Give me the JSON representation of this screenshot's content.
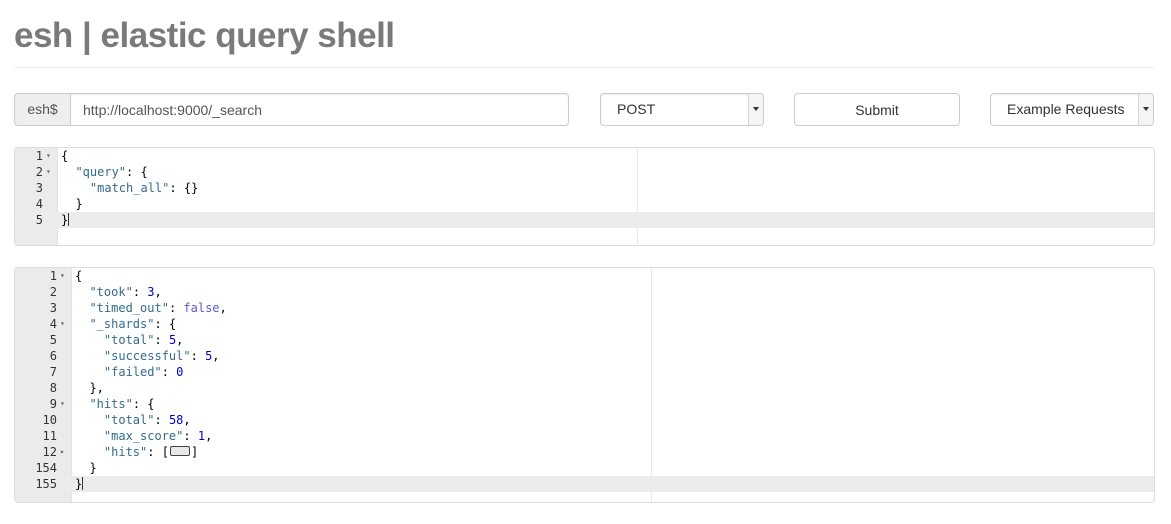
{
  "app": {
    "title": "esh | elastic query shell"
  },
  "toolbar": {
    "prompt": "esh$",
    "url_value": "http://localhost:9000/_search",
    "method_selected": "POST",
    "submit_label": "Submit",
    "examples_label": "Example Requests"
  },
  "request": {
    "lines": [
      {
        "num": "1",
        "fold": "▾",
        "parts": [
          {
            "t": "p",
            "v": "{"
          }
        ]
      },
      {
        "num": "2",
        "fold": "▾",
        "parts": [
          {
            "t": "p",
            "v": "  "
          },
          {
            "t": "k",
            "v": "\"query\""
          },
          {
            "t": "p",
            "v": ": {"
          }
        ]
      },
      {
        "num": "3",
        "fold": "",
        "parts": [
          {
            "t": "p",
            "v": "    "
          },
          {
            "t": "k",
            "v": "\"match_all\""
          },
          {
            "t": "p",
            "v": ": {}"
          }
        ]
      },
      {
        "num": "4",
        "fold": "",
        "parts": [
          {
            "t": "p",
            "v": "  }"
          }
        ]
      },
      {
        "num": "5",
        "fold": "",
        "active": true,
        "parts": [
          {
            "t": "p",
            "v": "}"
          },
          {
            "t": "c",
            "v": ""
          }
        ]
      }
    ]
  },
  "response": {
    "lines": [
      {
        "num": "1",
        "fold": "▾",
        "parts": [
          {
            "t": "p",
            "v": "{"
          }
        ]
      },
      {
        "num": "2",
        "fold": "",
        "parts": [
          {
            "t": "p",
            "v": "  "
          },
          {
            "t": "k",
            "v": "\"took\""
          },
          {
            "t": "p",
            "v": ": "
          },
          {
            "t": "n",
            "v": "3"
          },
          {
            "t": "p",
            "v": ","
          }
        ]
      },
      {
        "num": "3",
        "fold": "",
        "parts": [
          {
            "t": "p",
            "v": "  "
          },
          {
            "t": "k",
            "v": "\"timed_out\""
          },
          {
            "t": "p",
            "v": ": "
          },
          {
            "t": "b",
            "v": "false"
          },
          {
            "t": "p",
            "v": ","
          }
        ]
      },
      {
        "num": "4",
        "fold": "▾",
        "parts": [
          {
            "t": "p",
            "v": "  "
          },
          {
            "t": "k",
            "v": "\"_shards\""
          },
          {
            "t": "p",
            "v": ": {"
          }
        ]
      },
      {
        "num": "5",
        "fold": "",
        "parts": [
          {
            "t": "p",
            "v": "    "
          },
          {
            "t": "k",
            "v": "\"total\""
          },
          {
            "t": "p",
            "v": ": "
          },
          {
            "t": "n",
            "v": "5"
          },
          {
            "t": "p",
            "v": ","
          }
        ]
      },
      {
        "num": "6",
        "fold": "",
        "parts": [
          {
            "t": "p",
            "v": "    "
          },
          {
            "t": "k",
            "v": "\"successful\""
          },
          {
            "t": "p",
            "v": ": "
          },
          {
            "t": "n",
            "v": "5"
          },
          {
            "t": "p",
            "v": ","
          }
        ]
      },
      {
        "num": "7",
        "fold": "",
        "parts": [
          {
            "t": "p",
            "v": "    "
          },
          {
            "t": "k",
            "v": "\"failed\""
          },
          {
            "t": "p",
            "v": ": "
          },
          {
            "t": "n",
            "v": "0"
          }
        ]
      },
      {
        "num": "8",
        "fold": "",
        "parts": [
          {
            "t": "p",
            "v": "  },"
          }
        ]
      },
      {
        "num": "9",
        "fold": "▾",
        "parts": [
          {
            "t": "p",
            "v": "  "
          },
          {
            "t": "k",
            "v": "\"hits\""
          },
          {
            "t": "p",
            "v": ": {"
          }
        ]
      },
      {
        "num": "10",
        "fold": "",
        "parts": [
          {
            "t": "p",
            "v": "    "
          },
          {
            "t": "k",
            "v": "\"total\""
          },
          {
            "t": "p",
            "v": ": "
          },
          {
            "t": "n",
            "v": "58"
          },
          {
            "t": "p",
            "v": ","
          }
        ]
      },
      {
        "num": "11",
        "fold": "",
        "parts": [
          {
            "t": "p",
            "v": "    "
          },
          {
            "t": "k",
            "v": "\"max_score\""
          },
          {
            "t": "p",
            "v": ": "
          },
          {
            "t": "n",
            "v": "1"
          },
          {
            "t": "p",
            "v": ","
          }
        ]
      },
      {
        "num": "12",
        "fold": "▸",
        "parts": [
          {
            "t": "p",
            "v": "    "
          },
          {
            "t": "k",
            "v": "\"hits\""
          },
          {
            "t": "p",
            "v": ": ["
          },
          {
            "t": "f",
            "v": ""
          },
          {
            "t": "p",
            "v": "]"
          }
        ]
      },
      {
        "num": "154",
        "fold": "",
        "parts": [
          {
            "t": "p",
            "v": "  }"
          }
        ]
      },
      {
        "num": "155",
        "fold": "",
        "active": true,
        "parts": [
          {
            "t": "p",
            "v": "}"
          },
          {
            "t": "c",
            "v": ""
          }
        ]
      }
    ]
  },
  "icons": {
    "method_dropdown": "chevron-down-icon",
    "examples_dropdown": "chevron-down-icon",
    "fold_expanded": "fold-open-icon",
    "fold_collapsed": "fold-closed-icon"
  }
}
